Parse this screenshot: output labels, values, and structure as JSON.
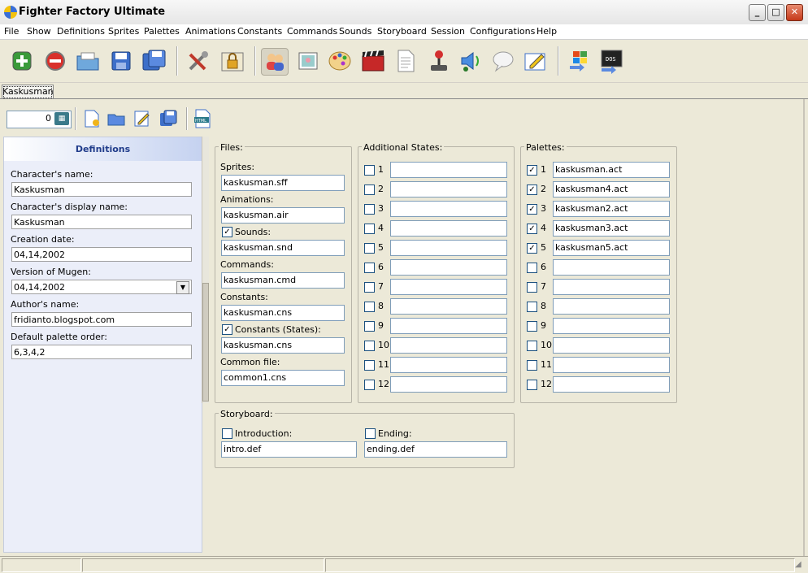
{
  "window": {
    "title": "Fighter Factory Ultimate"
  },
  "menu": [
    "File",
    "Show",
    "Definitions",
    "Sprites",
    "Palettes",
    "Animations",
    "Constants",
    "Commands",
    "Sounds",
    "Storyboard",
    "Session",
    "Configurations",
    "Help"
  ],
  "tab": {
    "label": "Kaskusman"
  },
  "counter": {
    "value": "0"
  },
  "definitions": {
    "header": "Definitions",
    "fields": [
      {
        "label": "Character's name:",
        "value": "Kaskusman"
      },
      {
        "label": "Character's display name:",
        "value": "Kaskusman"
      },
      {
        "label": "Creation date:",
        "value": "04,14,2002"
      },
      {
        "label": "Version of Mugen:",
        "value": "04,14,2002"
      },
      {
        "label": "Author's name:",
        "value": "fridianto.blogspot.com"
      },
      {
        "label": "Default palette order:",
        "value": "6,3,4,2"
      }
    ]
  },
  "files": {
    "title": "Files:",
    "sprites_label": "Sprites:",
    "sprites": "kaskusman.sff",
    "animations_label": "Animations:",
    "animations": "kaskusman.air",
    "sounds_label": "Sounds:",
    "sounds": "kaskusman.snd",
    "sounds_checked": true,
    "commands_label": "Commands:",
    "commands": "kaskusman.cmd",
    "constants_label": "Constants:",
    "constants": "kaskusman.cns",
    "constants_states_label": "Constants (States):",
    "constants_states": "kaskusman.cns",
    "constants_states_checked": true,
    "common_label": "Common file:",
    "common": "common1.cns"
  },
  "additional_states": {
    "title": "Additional States:",
    "rows": [
      {
        "n": "1",
        "value": ""
      },
      {
        "n": "2",
        "value": ""
      },
      {
        "n": "3",
        "value": ""
      },
      {
        "n": "4",
        "value": ""
      },
      {
        "n": "5",
        "value": ""
      },
      {
        "n": "6",
        "value": ""
      },
      {
        "n": "7",
        "value": ""
      },
      {
        "n": "8",
        "value": ""
      },
      {
        "n": "9",
        "value": ""
      },
      {
        "n": "10",
        "value": ""
      },
      {
        "n": "11",
        "value": ""
      },
      {
        "n": "12",
        "value": ""
      }
    ]
  },
  "palettes": {
    "title": "Palettes:",
    "rows": [
      {
        "n": "1",
        "value": "kaskusman.act",
        "checked": true
      },
      {
        "n": "2",
        "value": "kaskusman4.act",
        "checked": true
      },
      {
        "n": "3",
        "value": "kaskusman2.act",
        "checked": true
      },
      {
        "n": "4",
        "value": "kaskusman3.act",
        "checked": true
      },
      {
        "n": "5",
        "value": "kaskusman5.act",
        "checked": true
      },
      {
        "n": "6",
        "value": "",
        "checked": false
      },
      {
        "n": "7",
        "value": "",
        "checked": false
      },
      {
        "n": "8",
        "value": "",
        "checked": false
      },
      {
        "n": "9",
        "value": "",
        "checked": false
      },
      {
        "n": "10",
        "value": "",
        "checked": false
      },
      {
        "n": "11",
        "value": "",
        "checked": false
      },
      {
        "n": "12",
        "value": "",
        "checked": false
      }
    ]
  },
  "storyboard": {
    "title": "Storyboard:",
    "intro_label": "Introduction:",
    "intro": "intro.def",
    "ending_label": "Ending:",
    "ending": "ending.def"
  },
  "toolbar_icons": [
    "new-icon",
    "close-icon",
    "open-icon",
    "save-icon",
    "save-all-icon",
    "tools-icon",
    "lock-icon",
    "characters-icon",
    "sprite-icon",
    "palette-icon",
    "animation-icon",
    "document-icon",
    "joystick-icon",
    "sound-icon",
    "speech-icon",
    "edit-icon",
    "windows-icon",
    "dos-icon"
  ],
  "toolbar2_icons": [
    "new-file-icon",
    "open-folder-icon",
    "edit-doc-icon",
    "save-file-icon",
    "html-icon"
  ]
}
